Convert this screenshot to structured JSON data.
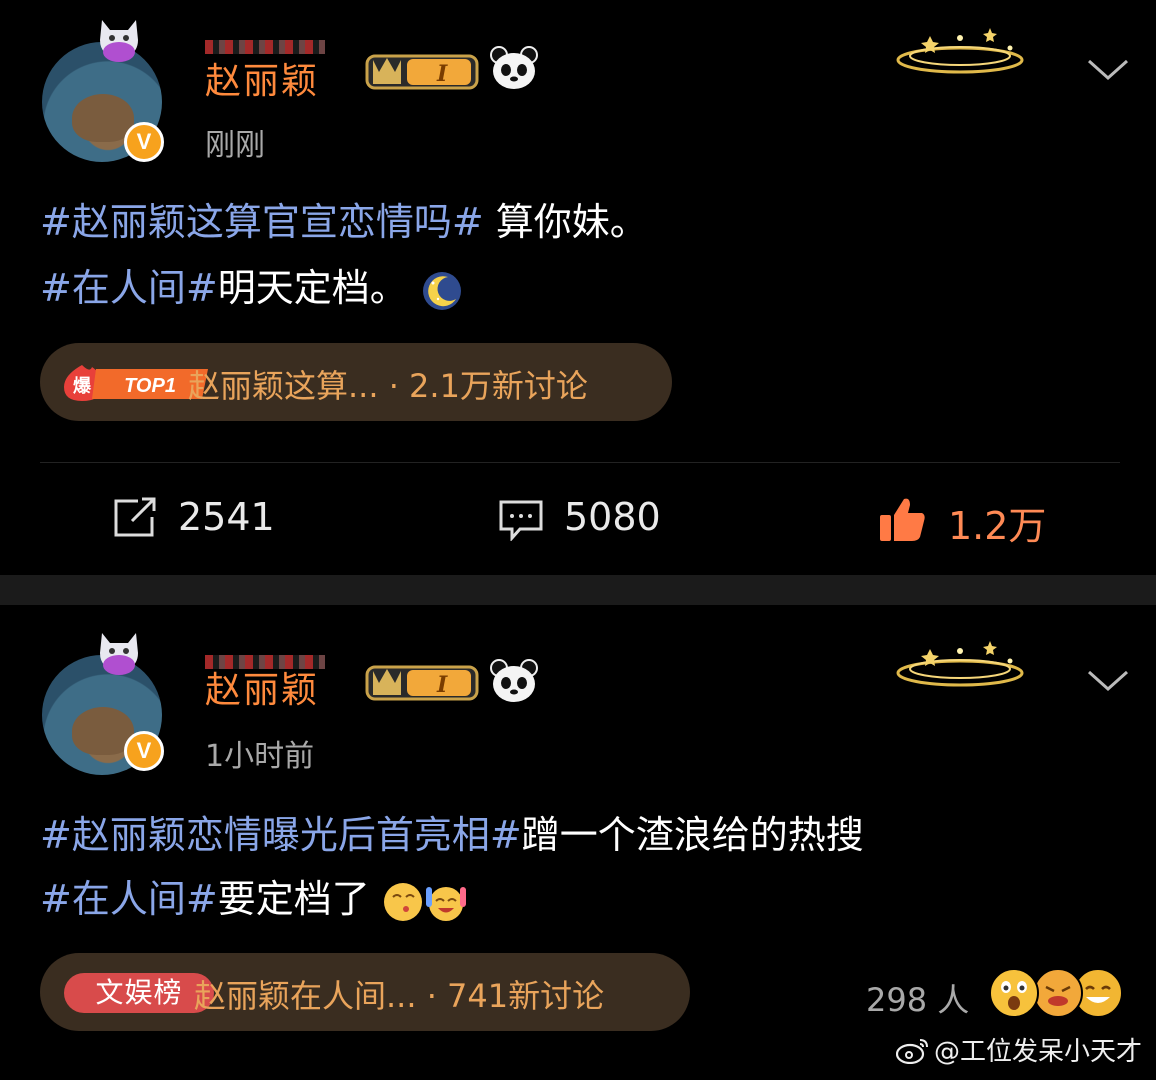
{
  "post1": {
    "user_name": "赵丽颖",
    "verified_mark": "V",
    "level_badge": "I",
    "time": "刚刚",
    "line1_tag": "#赵丽颖这算官宣恋情吗#",
    "line1_text": " 算你妹。",
    "line2_tag": "#在人间#",
    "line2_text": "明天定档。",
    "trend_badge_icon": "爆",
    "trend_badge_rank": "TOP1",
    "trend_text": "赵丽颖这算... · 2.1万新讨论",
    "repost_count": "2541",
    "comment_count": "5080",
    "like_count": "1.2万",
    "icons": [
      "repost-icon",
      "comment-icon",
      "thumbs-up-icon",
      "chevron-down-icon",
      "panda-icon",
      "crown-badge-icon",
      "moon-emoji-icon"
    ]
  },
  "post2": {
    "user_name": "赵丽颖",
    "verified_mark": "V",
    "level_badge": "I",
    "time": "1小时前",
    "line1_tag": "#赵丽颖恋情曝光后首亮相#",
    "line1_text": "蹭一个渣浪给的热搜",
    "line2_tag": "#在人间#",
    "line2_text": "要定档了",
    "trend_badge": "文娱榜",
    "trend_text": "赵丽颖在人间... · 741新讨论",
    "reaction_count": "298 人"
  },
  "watermark": "@工位发呆小天才",
  "colors": {
    "background": "#000000",
    "hashtag": "#8aa6e8",
    "username": "#ff8a3d",
    "trend_text": "#e9a45b",
    "like": "#ff7a45",
    "separator": "#1b1b1b"
  }
}
